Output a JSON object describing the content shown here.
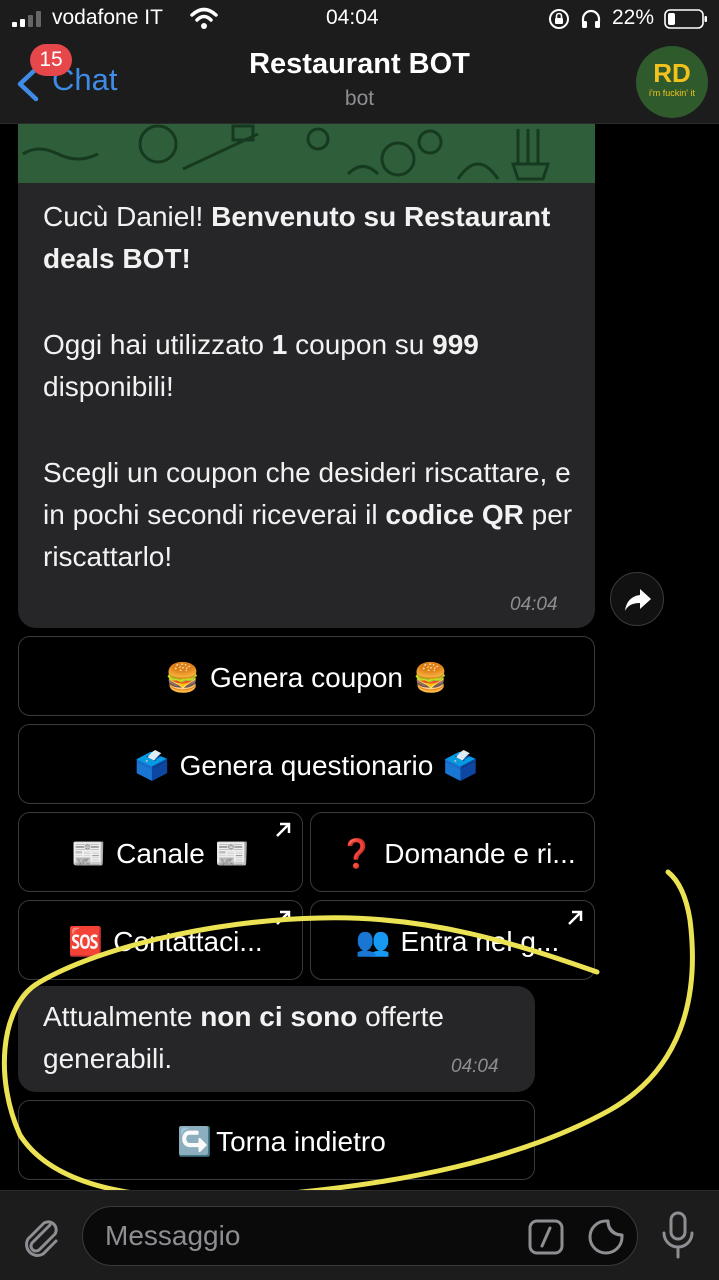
{
  "status_bar": {
    "carrier": "vodafone IT",
    "time": "04:04",
    "battery": "22%"
  },
  "header": {
    "back_label": "Chat",
    "unread_count": "15",
    "title": "Restaurant BOT",
    "subtitle": "bot",
    "avatar_initials": "RD",
    "avatar_tagline": "i'm fuckin' it"
  },
  "welcome_message": {
    "line1_plain": "Cucù Daniel! ",
    "line1_bold": "Benvenuto su Restaurant deals BOT!",
    "p2_a": "Oggi hai utilizzato ",
    "p2_b": "1",
    "p2_c": " coupon su ",
    "p2_d": "999",
    "p2_e": " disponibili!",
    "p3_a": "Scegli un coupon che desideri riscattare, e in pochi secondi riceverai il ",
    "p3_b": "codice QR",
    "p3_c": " per riscattarlo!",
    "time": "04:04"
  },
  "keyboard": {
    "generate_coupon": "Genera coupon",
    "generate_survey": "Genera questionario",
    "channel": "Canale",
    "faq": "Domande e ri...",
    "contact": "Contattaci...",
    "join_group": "Entra nel g..."
  },
  "info_message": {
    "a": "Attualmente ",
    "b": "non ci sono",
    "c": " offerte generabili.",
    "time": "04:04"
  },
  "back_button": {
    "label": "Torna indietro"
  },
  "composer": {
    "placeholder": "Messaggio"
  },
  "colors": {
    "accent": "#3e8ce6",
    "badge": "#e5474b",
    "bubble": "#262628",
    "annotation": "#ece354"
  }
}
